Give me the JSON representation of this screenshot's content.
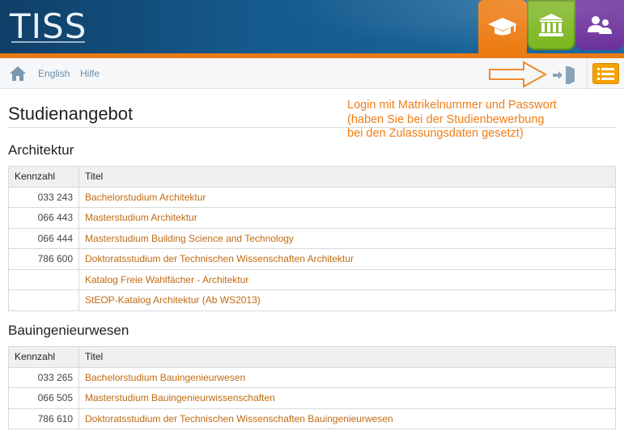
{
  "header": {
    "logo_text": "TISS",
    "tabs": [
      {
        "icon": "graduation-cap-icon",
        "color": "#ec7a10"
      },
      {
        "icon": "institution-building-icon",
        "color": "#7ab51d"
      },
      {
        "icon": "people-icon",
        "color": "#6a2f9a"
      }
    ],
    "accent_color": "#e87b14"
  },
  "toolbar": {
    "home_icon": "home-icon",
    "language_link": "English",
    "help_link": "Hilfe",
    "login_icon": "login-door-icon",
    "menu_icon": "list-menu-icon"
  },
  "annotation": {
    "lines": [
      "Login mit Matrikelnummer und Passwort",
      "(haben Sie bei der Studienbewerbung",
      "bei den Zulassungsdaten gesetzt)"
    ],
    "color": "#f07d18"
  },
  "page": {
    "title": "Studienangebot"
  },
  "sections": [
    {
      "heading": "Architektur",
      "columns": [
        "Kennzahl",
        "Titel"
      ],
      "rows": [
        {
          "code": "033 243",
          "title": "Bachelorstudium Architektur"
        },
        {
          "code": "066 443",
          "title": "Masterstudium Architektur"
        },
        {
          "code": "066 444",
          "title": "Masterstudium Building Science and Technology"
        },
        {
          "code": "786 600",
          "title": "Doktoratsstudium der Technischen Wissenschaften Architektur"
        },
        {
          "code": "",
          "title": "Katalog Freie Wahlfächer - Architektur"
        },
        {
          "code": "",
          "title": "StEOP-Katalog Architektur (Ab WS2013)"
        }
      ]
    },
    {
      "heading": "Bauingenieurwesen",
      "columns": [
        "Kennzahl",
        "Titel"
      ],
      "rows": [
        {
          "code": "033 265",
          "title": "Bachelorstudium Bauingenieurwesen"
        },
        {
          "code": "066 505",
          "title": "Masterstudium Bauingenieurwissenschaften"
        },
        {
          "code": "786 610",
          "title": "Doktoratsstudium der Technischen Wissenschaften Bauingenieurwesen"
        }
      ]
    }
  ],
  "link_color": "#c06b12"
}
